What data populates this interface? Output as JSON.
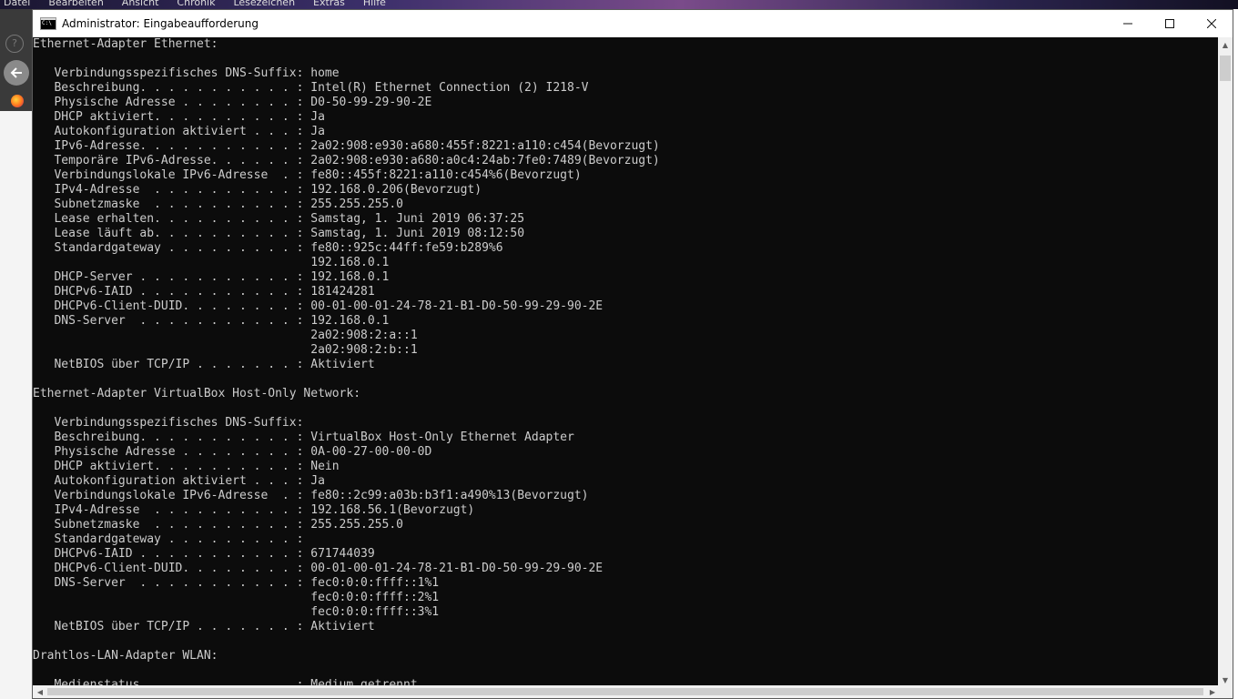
{
  "background": {
    "menu": [
      "Datei",
      "Bearbeiten",
      "Ansicht",
      "Chronik",
      "Lesezeichen",
      "Extras",
      "Hilfe"
    ]
  },
  "window": {
    "title": "Administrator: Eingabeaufforderung",
    "icon": "cmd-icon",
    "controls": [
      "minimize-icon",
      "maximize-icon",
      "close-icon"
    ]
  },
  "console": {
    "lines": [
      "Ethernet-Adapter Ethernet:",
      "",
      "   Verbindungsspezifisches DNS-Suffix: home",
      "   Beschreibung. . . . . . . . . . . : Intel(R) Ethernet Connection (2) I218-V",
      "   Physische Adresse . . . . . . . . : D0-50-99-29-90-2E",
      "   DHCP aktiviert. . . . . . . . . . : Ja",
      "   Autokonfiguration aktiviert . . . : Ja",
      "   IPv6-Adresse. . . . . . . . . . . : 2a02:908:e930:a680:455f:8221:a110:c454(Bevorzugt)",
      "   Temporäre IPv6-Adresse. . . . . . : 2a02:908:e930:a680:a0c4:24ab:7fe0:7489(Bevorzugt)",
      "   Verbindungslokale IPv6-Adresse  . : fe80::455f:8221:a110:c454%6(Bevorzugt)",
      "   IPv4-Adresse  . . . . . . . . . . : 192.168.0.206(Bevorzugt)",
      "   Subnetzmaske  . . . . . . . . . . : 255.255.255.0",
      "   Lease erhalten. . . . . . . . . . : Samstag, 1. Juni 2019 06:37:25",
      "   Lease läuft ab. . . . . . . . . . : Samstag, 1. Juni 2019 08:12:50",
      "   Standardgateway . . . . . . . . . : fe80::925c:44ff:fe59:b289%6",
      "                                       192.168.0.1",
      "   DHCP-Server . . . . . . . . . . . : 192.168.0.1",
      "   DHCPv6-IAID . . . . . . . . . . . : 181424281",
      "   DHCPv6-Client-DUID. . . . . . . . : 00-01-00-01-24-78-21-B1-D0-50-99-29-90-2E",
      "   DNS-Server  . . . . . . . . . . . : 192.168.0.1",
      "                                       2a02:908:2:a::1",
      "                                       2a02:908:2:b::1",
      "   NetBIOS über TCP/IP . . . . . . . : Aktiviert",
      "",
      "Ethernet-Adapter VirtualBox Host-Only Network:",
      "",
      "   Verbindungsspezifisches DNS-Suffix:",
      "   Beschreibung. . . . . . . . . . . : VirtualBox Host-Only Ethernet Adapter",
      "   Physische Adresse . . . . . . . . : 0A-00-27-00-00-0D",
      "   DHCP aktiviert. . . . . . . . . . : Nein",
      "   Autokonfiguration aktiviert . . . : Ja",
      "   Verbindungslokale IPv6-Adresse  . : fe80::2c99:a03b:b3f1:a490%13(Bevorzugt)",
      "   IPv4-Adresse  . . . . . . . . . . : 192.168.56.1(Bevorzugt)",
      "   Subnetzmaske  . . . . . . . . . . : 255.255.255.0",
      "   Standardgateway . . . . . . . . . :",
      "   DHCPv6-IAID . . . . . . . . . . . : 671744039",
      "   DHCPv6-Client-DUID. . . . . . . . : 00-01-00-01-24-78-21-B1-D0-50-99-29-90-2E",
      "   DNS-Server  . . . . . . . . . . . : fec0:0:0:ffff::1%1",
      "                                       fec0:0:0:ffff::2%1",
      "                                       fec0:0:0:ffff::3%1",
      "   NetBIOS über TCP/IP . . . . . . . : Aktiviert",
      "",
      "Drahtlos-LAN-Adapter WLAN:",
      "",
      "   Medienstatus. . . . . . . . . . . : Medium getrennt"
    ]
  }
}
